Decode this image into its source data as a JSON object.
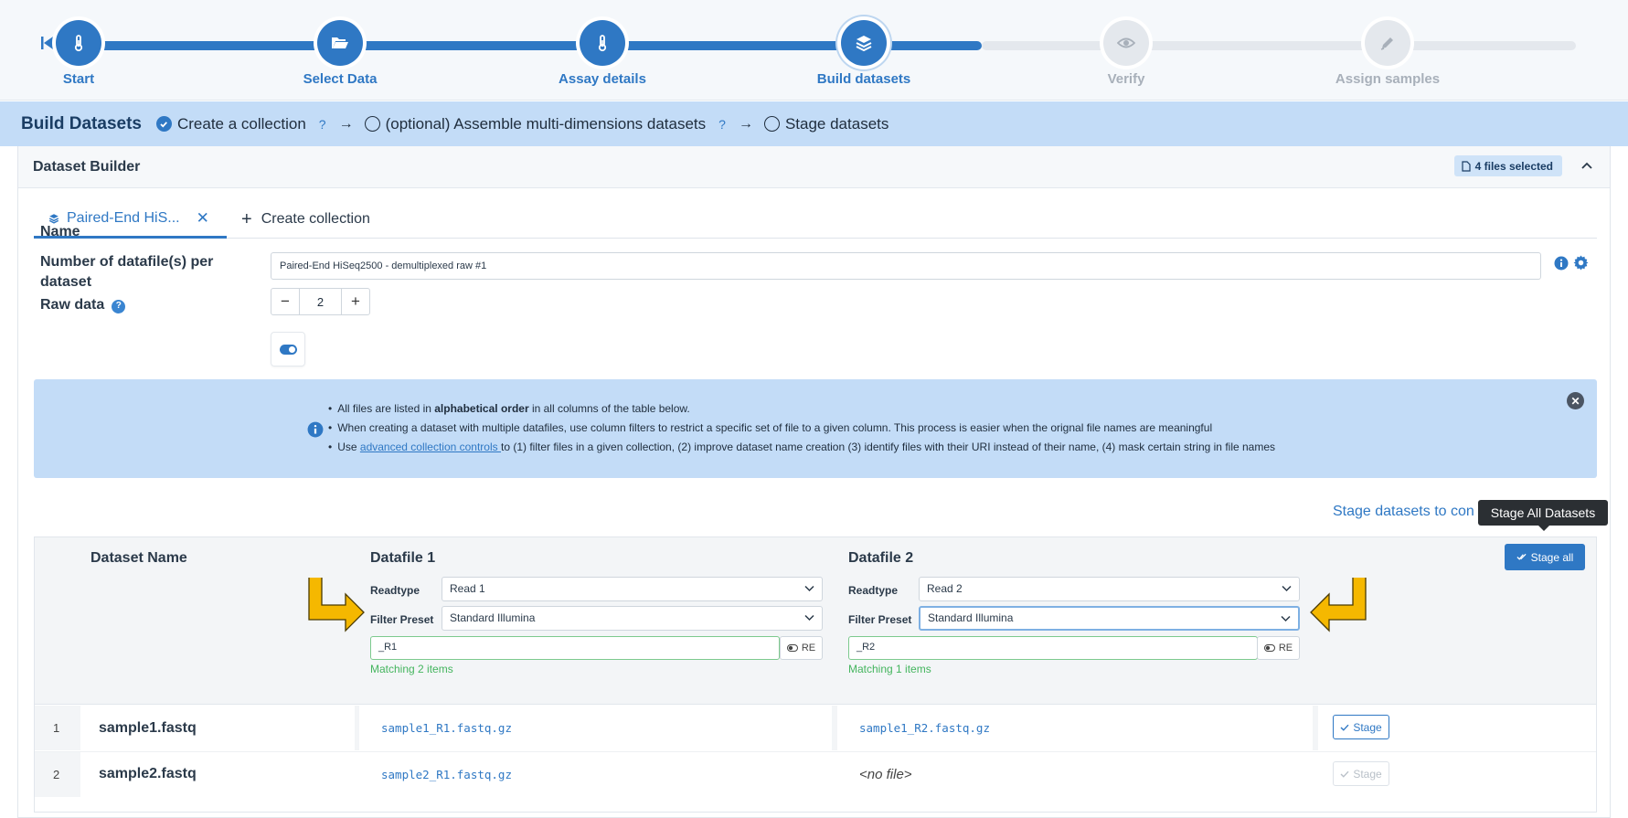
{
  "stepper": {
    "steps": [
      {
        "label": "Start",
        "state": "done",
        "icon": "thermometer-icon"
      },
      {
        "label": "Select Data",
        "state": "done",
        "icon": "folder-open-icon"
      },
      {
        "label": "Assay details",
        "state": "done",
        "icon": "thermometer-icon"
      },
      {
        "label": "Build datasets",
        "state": "current",
        "icon": "layers-icon"
      },
      {
        "label": "Verify",
        "state": "todo",
        "icon": "eye-icon"
      },
      {
        "label": "Assign samples",
        "state": "todo",
        "icon": "pen-icon"
      }
    ]
  },
  "build_bar": {
    "title": "Build Datasets",
    "step1": "Create a collection",
    "step2": "(optional) Assemble multi-dimensions datasets",
    "step3": "Stage datasets",
    "help": "?",
    "arrow": "→"
  },
  "builder": {
    "title": "Dataset Builder",
    "files_badge": "4 files selected",
    "tabs": {
      "active": "Paired-End HiS...",
      "close": "✕",
      "create": "Create collection",
      "plus": "+"
    },
    "form": {
      "name_label": "Name",
      "name_value": "Paired-End HiSeq2500 - demultiplexed raw #1",
      "count_label": "Number of datafile(s) per dataset",
      "count_minus": "−",
      "count_value": "2",
      "count_plus": "+",
      "raw_label": "Raw data",
      "raw_help": "?",
      "raw_enabled": true
    },
    "info": {
      "line1_a": "All files are listed in ",
      "line1_b": "alphabetical order",
      "line1_c": " in all columns of the table below.",
      "line2": "When creating a dataset with multiple datafiles, use column filters to restrict a specific set of file to a given column. This process is easier when the orignal file names are meaningful",
      "line3_a": "Use ",
      "line3_link": "advanced collection controls ",
      "line3_b": "to (1) filter files in a given collection, (2) improve dataset name creation (3) identify files with their URI instead of their name, (4) mask certain string in file names",
      "close": "✕"
    },
    "stage_link": "Stage datasets to con",
    "tooltip": "Stage All Datasets",
    "table": {
      "col_name": "Dataset Name",
      "col_df1": "Datafile 1",
      "col_df2": "Datafile 2",
      "stage_all": "Stage all",
      "readtype_label": "Readtype",
      "filter_label": "Filter Preset",
      "re_label": "RE",
      "df1": {
        "readtype": "Read 1",
        "preset": "Standard Illumina",
        "filter": "_R1",
        "match": "Matching 2 items"
      },
      "df2": {
        "readtype": "Read 2",
        "preset": "Standard Illumina",
        "filter": "_R2",
        "match": "Matching 1 items"
      },
      "rows": [
        {
          "num": "1",
          "name": "sample1.fastq",
          "f1": "sample1_R1.fastq.gz",
          "f2": "sample1_R2.fastq.gz",
          "stage": "Stage",
          "stage_enabled": true
        },
        {
          "num": "2",
          "name": "sample2.fastq",
          "f1": "sample2_R1.fastq.gz",
          "f2": "<no file>",
          "stage": "Stage",
          "stage_enabled": false
        }
      ]
    }
  },
  "colors": {
    "accent": "#2f78c4",
    "bar_bg": "#c3dcf7",
    "success": "#44b55e",
    "annotation_arrow": "#f5b800"
  }
}
